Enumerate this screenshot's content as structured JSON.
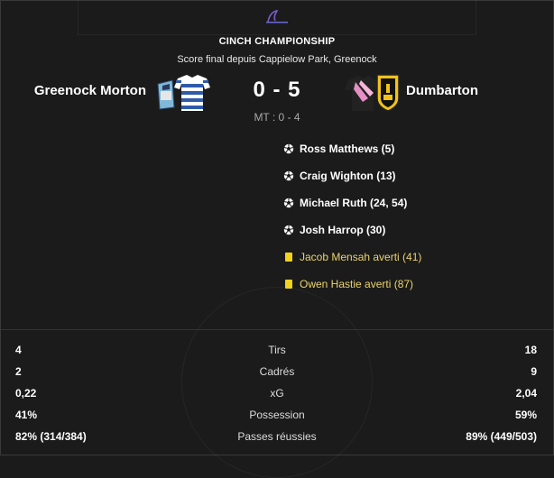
{
  "competition": {
    "title": "CINCH CHAMPIONSHIP",
    "logo_icon": "cinch-championship-logo"
  },
  "venue_text": "Score final depuis Cappielow Park, Greenock",
  "home": {
    "name": "Greenock Morton",
    "kit_icon": "greenock-morton-kit-icon"
  },
  "away": {
    "name": "Dumbarton",
    "kit_icon": "dumbarton-kit-icon"
  },
  "score": "0 - 5",
  "halftime": "MT : 0 - 4",
  "events": [
    {
      "type": "goal",
      "icon": "football-icon",
      "text": "Ross Matthews (5)"
    },
    {
      "type": "goal",
      "icon": "football-icon",
      "text": "Craig Wighton (13)"
    },
    {
      "type": "goal",
      "icon": "football-icon",
      "text": "Michael Ruth (24, 54)"
    },
    {
      "type": "goal",
      "icon": "football-icon",
      "text": "Josh Harrop (30)"
    },
    {
      "type": "card",
      "icon": "yellow-card-icon",
      "text": "Jacob Mensah averti (41)"
    },
    {
      "type": "card",
      "icon": "yellow-card-icon",
      "text": "Owen Hastie averti (87)"
    }
  ],
  "stats": [
    {
      "label": "Tirs",
      "home": "4",
      "away": "18"
    },
    {
      "label": "Cadrés",
      "home": "2",
      "away": "9"
    },
    {
      "label": "xG",
      "home": "0,22",
      "away": "2,04"
    },
    {
      "label": "Possession",
      "home": "41%",
      "away": "59%"
    },
    {
      "label": "Passes réussies",
      "home": "82% (314/384)",
      "away": "89% (449/503)"
    }
  ],
  "colors": {
    "background": "#1b1b1b",
    "card_text": "#e9d36b",
    "yellow_card": "#f1d21e"
  }
}
